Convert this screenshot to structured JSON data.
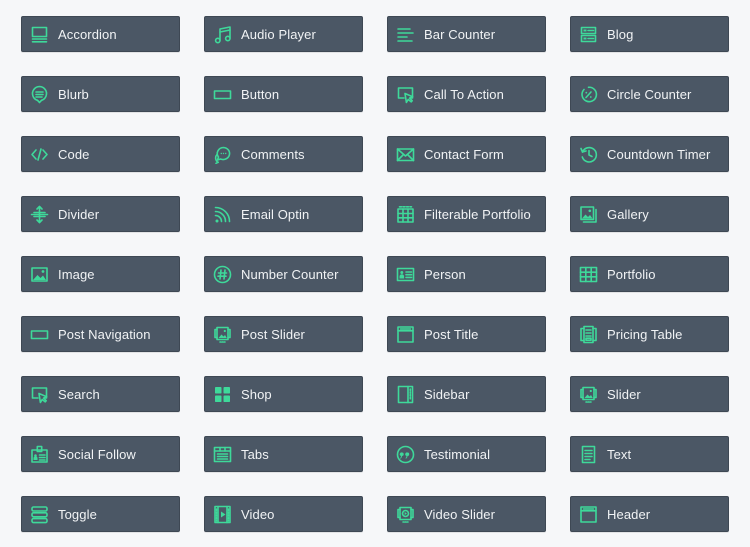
{
  "colors": {
    "accent": "#3ed99a",
    "tile": "#4b5765",
    "background": "#f6f7f9"
  },
  "modules": [
    {
      "label": "Accordion",
      "icon": "accordion-icon"
    },
    {
      "label": "Audio Player",
      "icon": "music-note-icon"
    },
    {
      "label": "Bar Counter",
      "icon": "bar-counter-icon"
    },
    {
      "label": "Blog",
      "icon": "blog-icon"
    },
    {
      "label": "Blurb",
      "icon": "blurb-icon"
    },
    {
      "label": "Button",
      "icon": "button-icon"
    },
    {
      "label": "Call To Action",
      "icon": "call-to-action-icon"
    },
    {
      "label": "Circle Counter",
      "icon": "circle-counter-icon"
    },
    {
      "label": "Code",
      "icon": "code-icon"
    },
    {
      "label": "Comments",
      "icon": "comments-icon"
    },
    {
      "label": "Contact Form",
      "icon": "envelope-icon"
    },
    {
      "label": "Countdown Timer",
      "icon": "countdown-timer-icon"
    },
    {
      "label": "Divider",
      "icon": "divider-icon"
    },
    {
      "label": "Email Optin",
      "icon": "rss-icon"
    },
    {
      "label": "Filterable Portfolio",
      "icon": "filterable-portfolio-icon"
    },
    {
      "label": "Gallery",
      "icon": "gallery-icon"
    },
    {
      "label": "Image",
      "icon": "image-icon"
    },
    {
      "label": "Number Counter",
      "icon": "hash-icon"
    },
    {
      "label": "Person",
      "icon": "person-card-icon"
    },
    {
      "label": "Portfolio",
      "icon": "portfolio-grid-icon"
    },
    {
      "label": "Post Navigation",
      "icon": "post-navigation-icon"
    },
    {
      "label": "Post Slider",
      "icon": "post-slider-icon"
    },
    {
      "label": "Post Title",
      "icon": "post-title-icon"
    },
    {
      "label": "Pricing Table",
      "icon": "pricing-table-icon"
    },
    {
      "label": "Search",
      "icon": "search-cursor-icon"
    },
    {
      "label": "Shop",
      "icon": "shop-grid-icon"
    },
    {
      "label": "Sidebar",
      "icon": "sidebar-icon"
    },
    {
      "label": "Slider",
      "icon": "slider-icon"
    },
    {
      "label": "Social Follow",
      "icon": "social-follow-icon"
    },
    {
      "label": "Tabs",
      "icon": "tabs-icon"
    },
    {
      "label": "Testimonial",
      "icon": "quote-icon"
    },
    {
      "label": "Text",
      "icon": "text-document-icon"
    },
    {
      "label": "Toggle",
      "icon": "toggle-icon"
    },
    {
      "label": "Video",
      "icon": "film-icon"
    },
    {
      "label": "Video Slider",
      "icon": "video-slider-icon"
    },
    {
      "label": "Header",
      "icon": "header-icon"
    }
  ]
}
